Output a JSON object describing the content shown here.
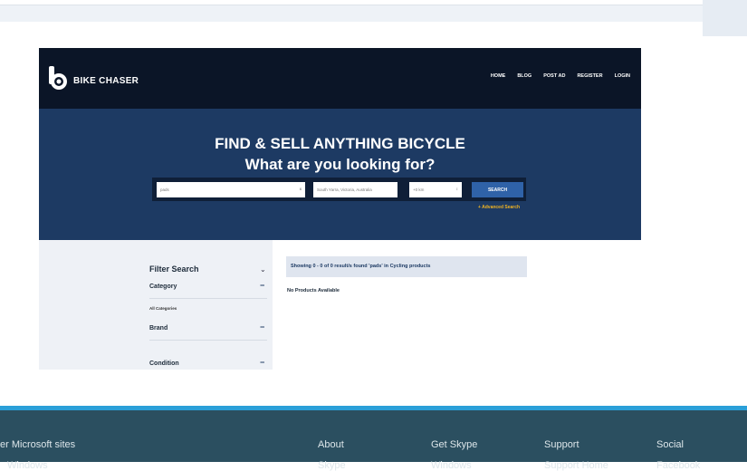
{
  "site": {
    "brand": "BIKE CHASER",
    "nav": [
      "HOME",
      "BLOG",
      "POST AD",
      "REGISTER",
      "LOGIN"
    ]
  },
  "hero": {
    "title": "FIND & SELL ANYTHING BICYCLE",
    "subtitle": "What are you looking for?",
    "search_value": "pads",
    "clear_glyph": "x",
    "location_value": "South Yarra, Victoria, Australia",
    "radius_value": "+0 km",
    "stepper_glyph": "↕",
    "search_button": "SEARCH",
    "advanced_search": "+ Advanced Search"
  },
  "filters": {
    "title": "Filter Search",
    "chevron": "⌄",
    "category": "Category",
    "all_categories": "All Categories",
    "brand": "Brand",
    "condition": "Condition",
    "collapse_glyph": "−"
  },
  "results": {
    "summary": "Showing 0 - 0 of 0 result/s found 'pads' in Cycling products",
    "empty": "No Products Available"
  },
  "footer": {
    "col1": "er Microsoft sites",
    "col2": "About",
    "col3": "Get Skype",
    "col4": "Support",
    "col5": "Social",
    "row2": [
      "Windows",
      "Skype",
      "Windows",
      "Support Home",
      "Facebook"
    ]
  },
  "colors": {
    "nav_bg": "#0b1527",
    "hero_bg": "#1d3a63",
    "accent": "#2f62a8",
    "advanced": "#f0b323",
    "footer_bg": "#2b4f60",
    "footer_border": "#2a9fd8"
  }
}
